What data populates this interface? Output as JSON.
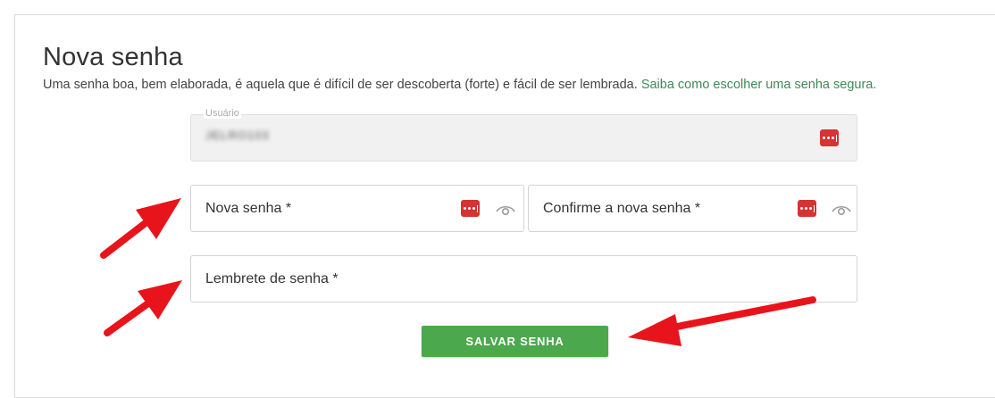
{
  "page": {
    "title": "Nova senha",
    "subtitle_text": "Uma senha boa, bem elaborada, é aquela que é difícil de ser descoberta (forte) e fácil de ser lembrada. ",
    "subtitle_link": "Saiba como escolher uma senha segura."
  },
  "form": {
    "username_label": "Usuário",
    "username_value": "JELRO103",
    "new_password_label": "Nova senha *",
    "confirm_password_label": "Confirme a nova senha *",
    "reminder_label": "Lembrete de senha *",
    "save_label": "SALVAR SENHA"
  },
  "icons": {
    "password_manager": "password-manager-icon",
    "show_password": "eye-icon",
    "annotation": "red-arrow"
  },
  "colors": {
    "accent_green": "#4ca84c",
    "link_green": "#3d8a55",
    "password_manager_red": "#d63333",
    "annotation_red": "#e8141b"
  }
}
